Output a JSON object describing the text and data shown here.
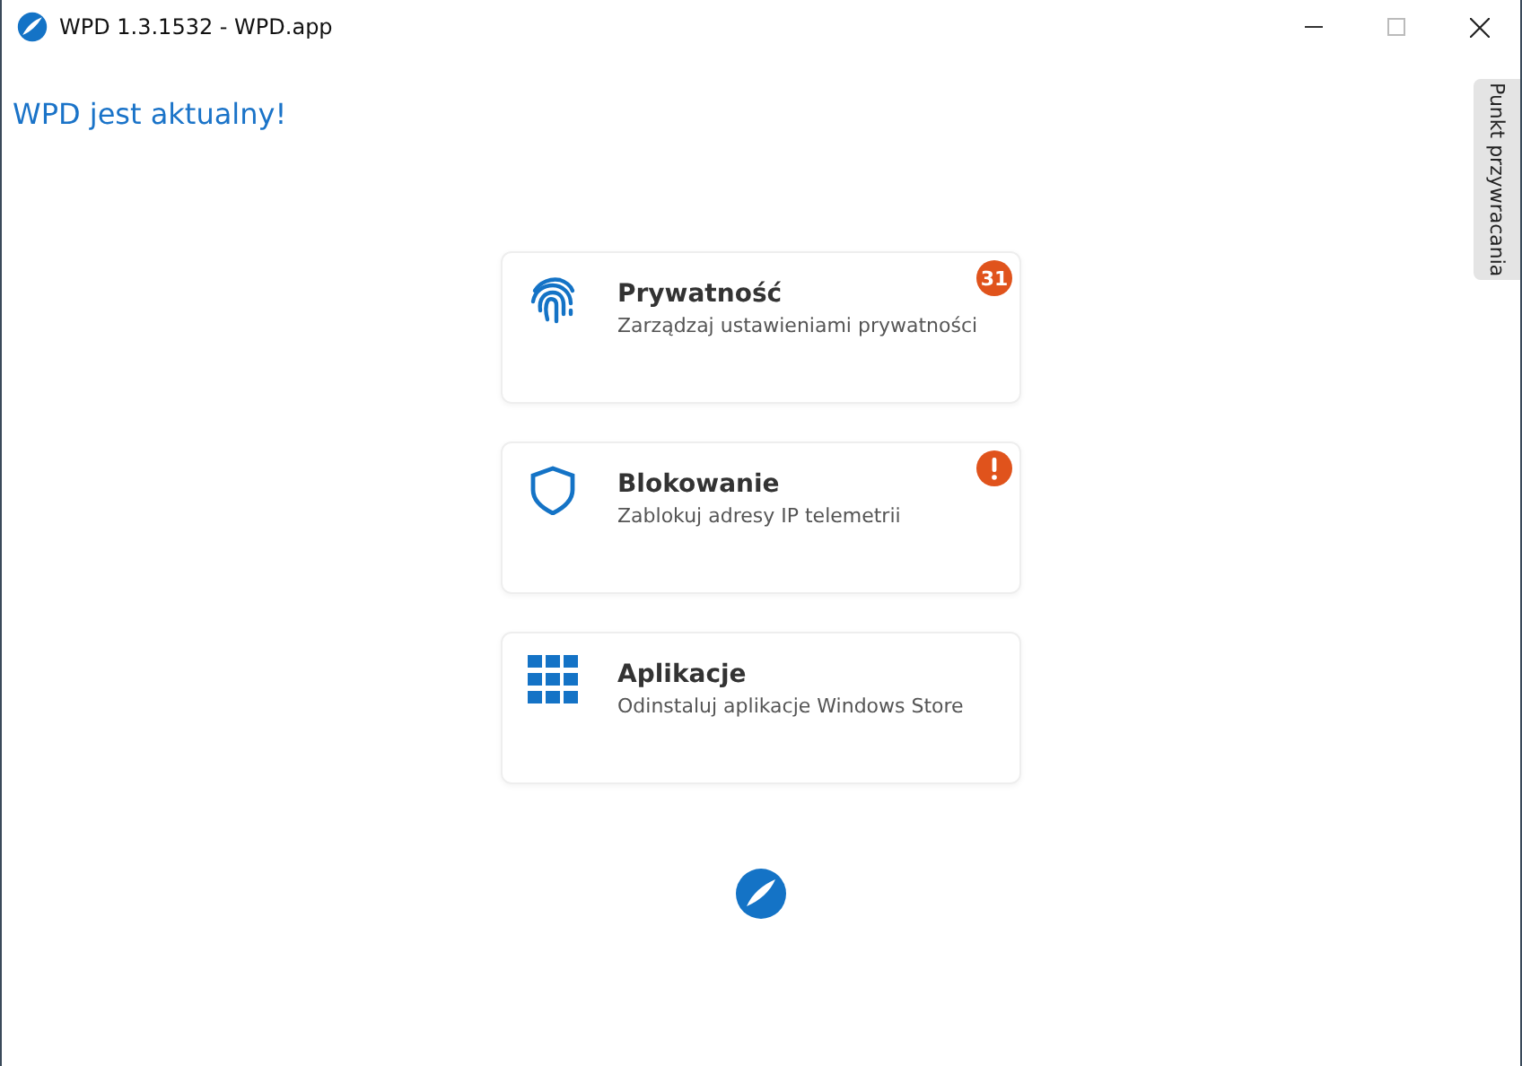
{
  "window": {
    "title": "WPD 1.3.1532 - WPD.app"
  },
  "heading": "WPD jest aktualny!",
  "side_tab": {
    "label": "Punkt przywracania"
  },
  "cards": [
    {
      "kind": "fingerprint",
      "title": "Prywatność",
      "subtitle": "Zarządzaj ustawieniami prywatności",
      "badge": {
        "kind": "count",
        "text": "31"
      }
    },
    {
      "kind": "shield",
      "title": "Blokowanie",
      "subtitle": "Zablokuj adresy IP telemetrii",
      "badge": {
        "kind": "alert"
      }
    },
    {
      "kind": "grid",
      "title": "Aplikacje",
      "subtitle": "Odinstaluj aplikacje Windows Store"
    }
  ]
}
